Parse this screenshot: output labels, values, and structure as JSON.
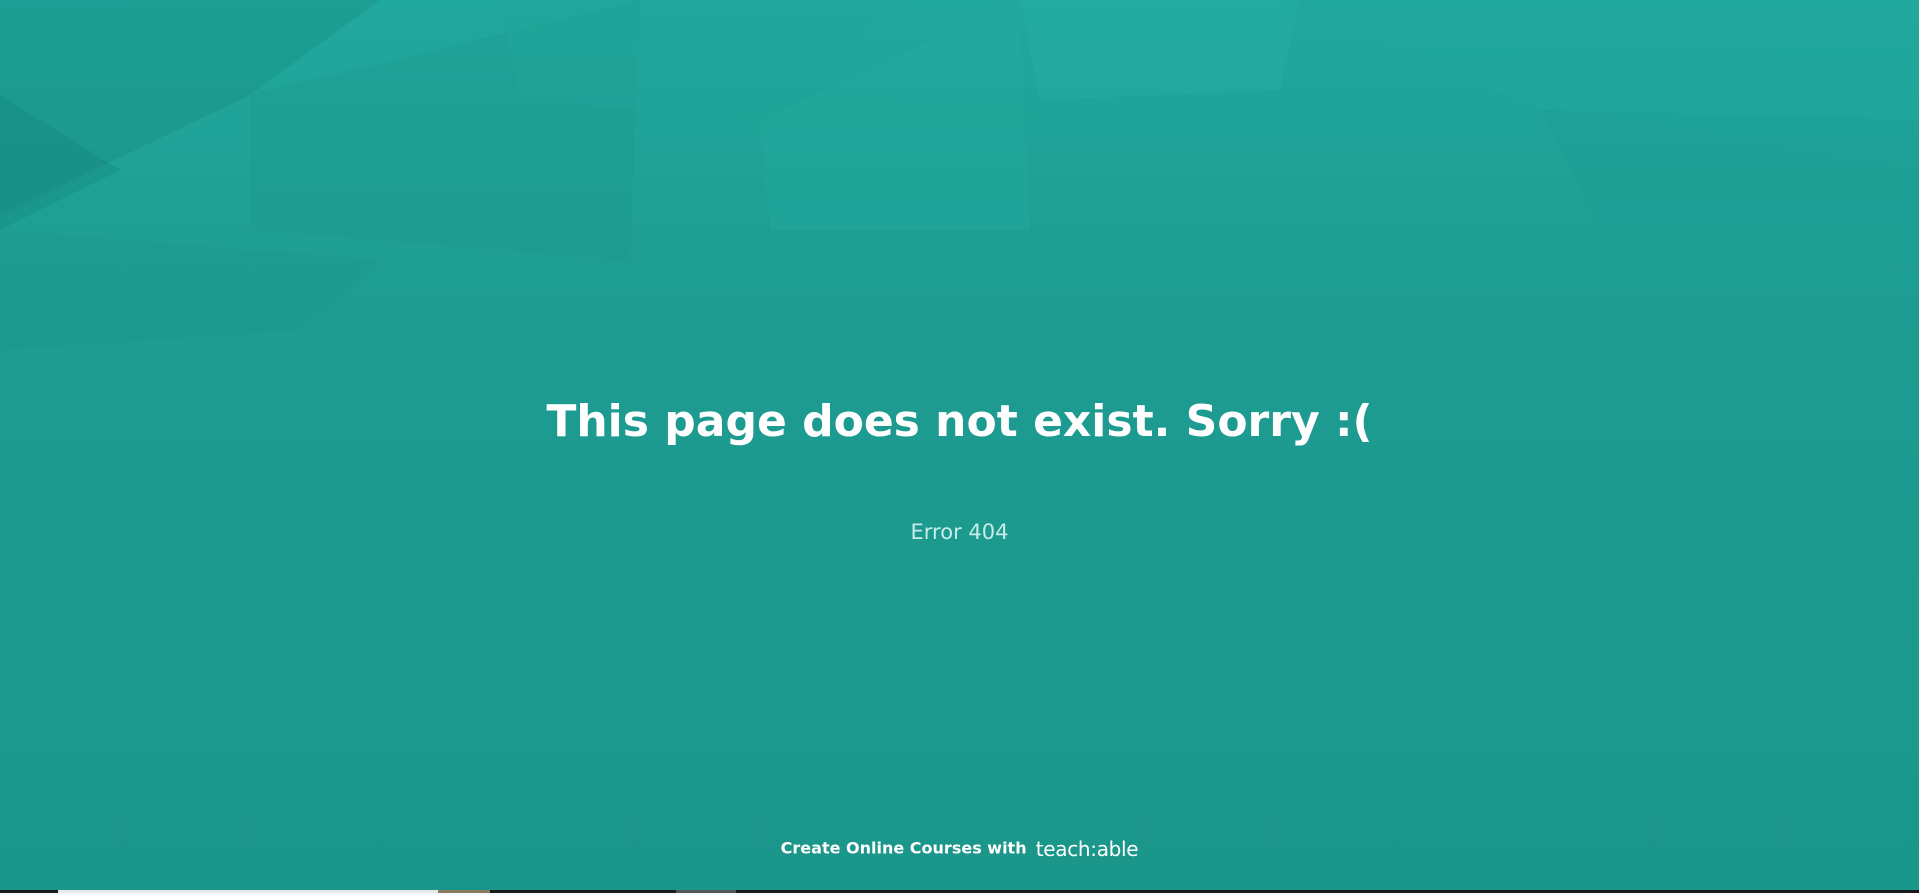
{
  "page": {
    "background_color": "#1b9488"
  },
  "error": {
    "title": "This page does not exist. Sorry :(",
    "code": "Error 404"
  },
  "footer": {
    "text": "Create Online Courses with",
    "brand": "teach:able"
  }
}
